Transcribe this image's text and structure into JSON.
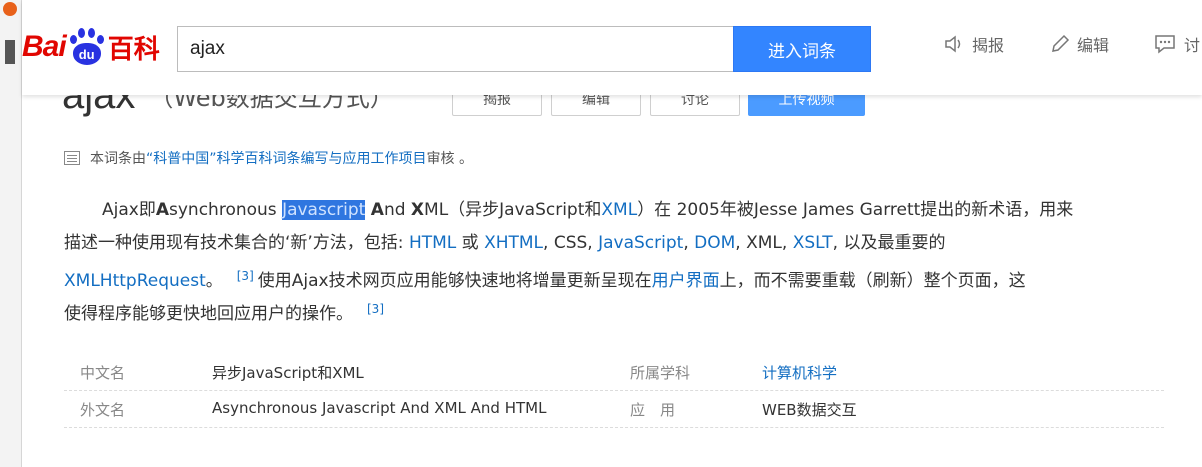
{
  "header": {
    "logo": {
      "bai": "Bai",
      "du": "du",
      "baike": "百科"
    },
    "search": {
      "value": "ajax"
    },
    "search_button": "进入词条",
    "actions": {
      "report": "揭报",
      "edit": "编辑",
      "discuss": "讨"
    }
  },
  "title": {
    "word": "ajax",
    "subtitle": "（Web数据交互方式）",
    "buttons": {
      "b1": "揭报",
      "b2": "编辑",
      "b3": "讨论",
      "b4": "上传视频"
    }
  },
  "review": {
    "prefix": "本词条由",
    "link": "“科普中国”科学百科词条编写与应用工作项目",
    "suffix": " 审核 。"
  },
  "paragraph": {
    "l1_a": "Ajax即",
    "l1_b": "A",
    "l1_c": "synchronous ",
    "l1_hl": "Javascript",
    "l1_d": " ",
    "l1_e": "A",
    "l1_f": "nd ",
    "l1_g": "X",
    "l1_h": "ML（异步JavaScript和",
    "l1_xml": "XML",
    "l1_i": "）在 2005年被Jesse James Garrett提出的新术语，用来",
    "l2_a": "描述一种使用现有技术集合的‘新’方法，包括: ",
    "l2_html": "HTML",
    "l2_or": " 或 ",
    "l2_xhtml": "XHTML",
    "l2_css": ", CSS, ",
    "l2_js": "JavaScript",
    "l2_sep": ", ",
    "l2_dom": "DOM",
    "l2_xml": ", XML, ",
    "l2_xslt": "XSLT",
    "l2_end": ", 以及最重要的",
    "l3_xhr": "XMLHttpRequest",
    "l3_dot": "。",
    "l3_ref": "[3]",
    "l3_a": "使用Ajax技术网页应用能够快速地将增量更新呈现在",
    "l3_ui": "用户界面",
    "l3_b": "上，而不需要重载（刷新）整个页面，这",
    "l4_a": "使得程序能够更快地回应用户的操作。",
    "l4_ref": "[3]"
  },
  "info": {
    "r1": {
      "k1": "中文名",
      "v1": "异步JavaScript和XML",
      "k2": "所属学科",
      "v2": "计算机科学"
    },
    "r2": {
      "k1": "外文名",
      "v1": "Asynchronous Javascript And XML And HTML",
      "k2": "应　用",
      "v2": "WEB数据交互"
    }
  },
  "colors": {
    "brand_red": "#e10601",
    "brand_blue": "#2932e1",
    "search_btn": "#3385ff",
    "link": "#136ec2"
  }
}
